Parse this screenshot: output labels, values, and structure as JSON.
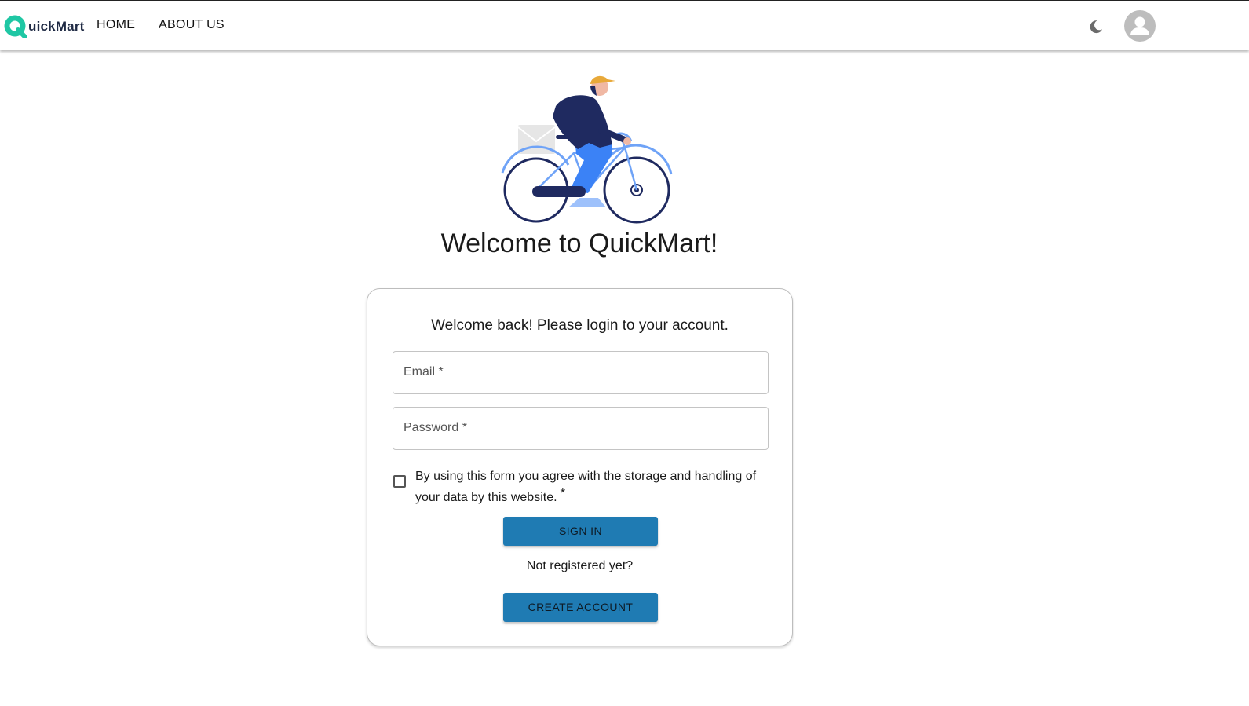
{
  "header": {
    "logo_text": "uickMart",
    "nav": [
      {
        "label": "HOME"
      },
      {
        "label": "ABOUT US"
      }
    ],
    "theme_icon": "moon-icon",
    "avatar_icon": "person-icon"
  },
  "hero": {
    "illustration": "delivery-cyclist-illustration",
    "title": "Welcome to QuickMart!"
  },
  "login_card": {
    "subtitle": "Welcome back! Please login to your account.",
    "email": {
      "label": "Email *",
      "value": ""
    },
    "password": {
      "label": "Password *",
      "value": ""
    },
    "consent": {
      "text": "By using this form you agree with the storage and handling of your data by this website.",
      "required_mark": "*",
      "checked": false
    },
    "sign_in_label": "SIGN IN",
    "register_prompt": "Not registered yet?",
    "create_account_label": "CREATE ACCOUNT"
  },
  "colors": {
    "brand_green": "#1fc7a4",
    "button_blue": "#1f7bb3",
    "navy": "#1f2a60",
    "cyclist_blue": "#3b82f6"
  }
}
